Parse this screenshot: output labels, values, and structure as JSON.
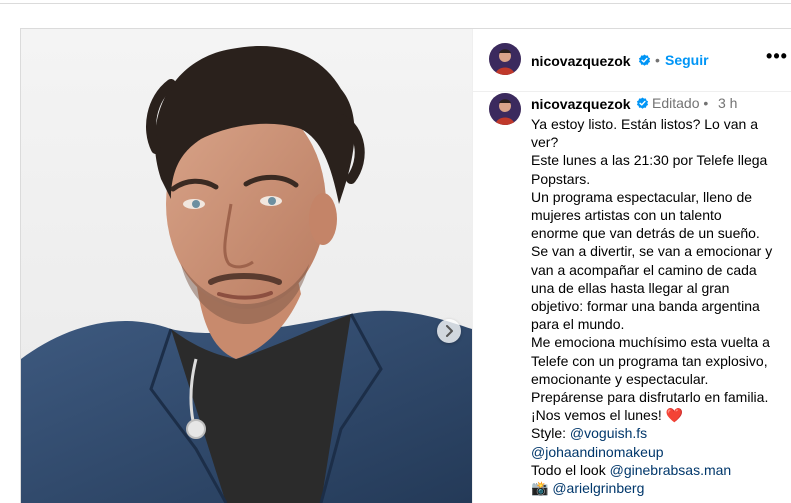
{
  "post": {
    "author": {
      "username": "nicovazquezok",
      "verified": true
    },
    "header": {
      "separator": "•",
      "follow_label": "Seguir",
      "more_label": "•••"
    },
    "caption_meta": {
      "edited": "Editado",
      "separator": "•",
      "time": "3 h"
    },
    "caption_lines": [
      "Ya estoy listo. Están listos? Lo van a",
      "ver?",
      "Este lunes a las 21:30 por Telefe llega",
      "Popstars.",
      "Un programa espectacular, lleno de",
      "mujeres artistas con un talento",
      "enorme que van detrás de un sueño.",
      "Se van a divertir, se van a emocionar y",
      "van a acompañar el camino de cada",
      "una de ellas hasta llegar al gran",
      "objetivo: formar una banda argentina",
      "para el mundo.",
      "Me emociona muchísimo esta vuelta a",
      "Telefe con un programa tan explosivo,",
      "emocionante y espectacular.",
      "Prepárense para disfrutarlo en familia.",
      "¡Nos vemos el lunes!"
    ],
    "heart_emoji": "❤️",
    "credits": {
      "style_label": "Style:",
      "style_mention": "@voguish.fs",
      "makeup_mention": "@johaandinomakeup",
      "look_label": "Todo el look",
      "look_mention": "@ginebrabsas.man",
      "camera_emoji": "📸",
      "photo_mention": "@arielgrinberg"
    }
  },
  "icons": {
    "verified": "verified-badge-icon",
    "carousel_next": "chevron-right-icon"
  },
  "colors": {
    "link_blue": "#0095f6",
    "mention": "#00376b",
    "verified": "#0095f6",
    "muted": "#737373",
    "border": "#dbdbdb",
    "heart": "#e0245e",
    "denim": "#2f4a6e"
  }
}
